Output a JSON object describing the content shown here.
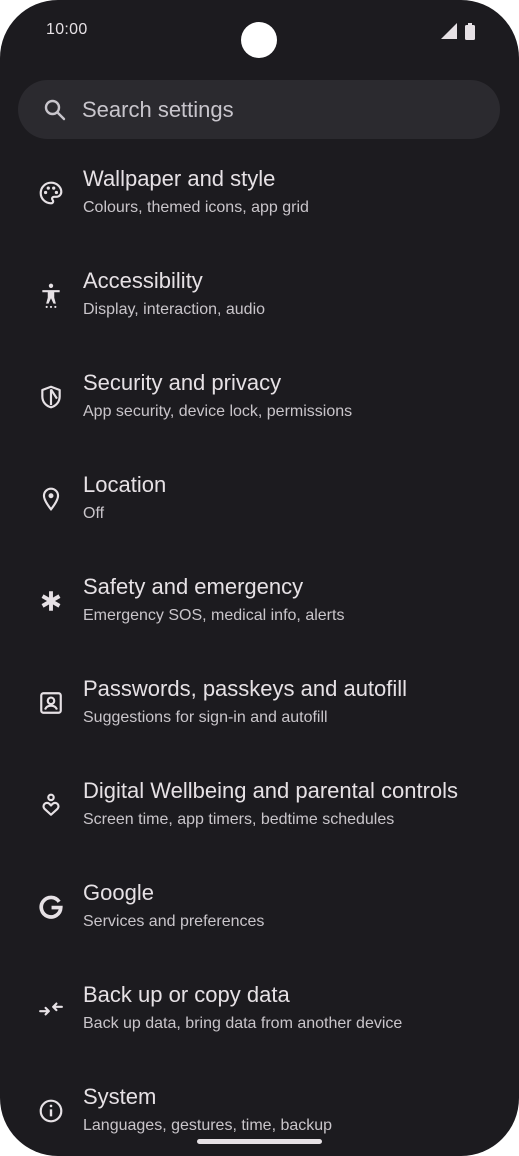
{
  "status_bar": {
    "time": "10:00",
    "icons": [
      "signal-icon",
      "battery-icon"
    ]
  },
  "search": {
    "placeholder": "Search settings",
    "icon": "search-icon"
  },
  "settings": [
    {
      "icon": "palette-icon",
      "title": "Wallpaper and style",
      "subtitle": "Colours, themed icons, app grid"
    },
    {
      "icon": "accessibility-icon",
      "title": "Accessibility",
      "subtitle": "Display, interaction, audio"
    },
    {
      "icon": "shield-icon",
      "title": "Security and privacy",
      "subtitle": "App security, device lock, permissions"
    },
    {
      "icon": "location-pin-icon",
      "title": "Location",
      "subtitle": "Off"
    },
    {
      "icon": "asterisk-icon",
      "title": "Safety and emergency",
      "subtitle": "Emergency SOS, medical info, alerts"
    },
    {
      "icon": "account-box-icon",
      "title": "Passwords, passkeys and autofill",
      "subtitle": "Suggestions for sign-in and autofill"
    },
    {
      "icon": "wellbeing-icon",
      "title": "Digital Wellbeing and parental controls",
      "subtitle": "Screen time, app timers, bedtime schedules"
    },
    {
      "icon": "google-g-icon",
      "title": "Google",
      "subtitle": "Services and preferences"
    },
    {
      "icon": "transfer-arrows-icon",
      "title": "Back up or copy data",
      "subtitle": "Back up data, bring data from another device"
    },
    {
      "icon": "info-icon",
      "title": "System",
      "subtitle": "Languages, gestures, time, backup"
    }
  ],
  "colors": {
    "background": "#1c1b1f",
    "search_bar": "#2b2a2f",
    "primary_text": "#e6e1e5",
    "secondary_text": "#c9c5ca"
  }
}
